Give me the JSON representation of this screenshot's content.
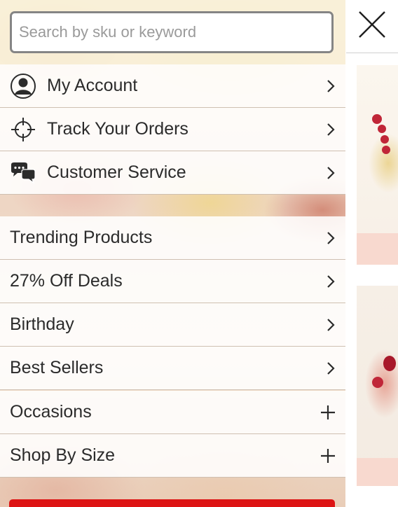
{
  "search": {
    "placeholder": "Search by sku or keyword",
    "value": ""
  },
  "account_menu": [
    {
      "label": "My Account",
      "icon": "user-icon",
      "trail": "chevron-right-icon"
    },
    {
      "label": "Track Your Orders",
      "icon": "crosshair-icon",
      "trail": "chevron-right-icon"
    },
    {
      "label": "Customer Service",
      "icon": "chat-bubbles-icon",
      "trail": "chevron-right-icon"
    }
  ],
  "shop_menu": [
    {
      "label": "Trending Products",
      "trail": "chevron-right-icon"
    },
    {
      "label": "27% Off Deals",
      "trail": "chevron-right-icon"
    },
    {
      "label": "Birthday",
      "trail": "chevron-right-icon"
    },
    {
      "label": "Best Sellers",
      "trail": "chevron-right-icon"
    },
    {
      "label": "Occasions",
      "trail": "plus-icon"
    },
    {
      "label": "Shop By Size",
      "trail": "plus-icon"
    }
  ],
  "colors": {
    "accent_red": "#dd1414",
    "text": "#2b2b2b",
    "icon": "#2b2b2b"
  }
}
